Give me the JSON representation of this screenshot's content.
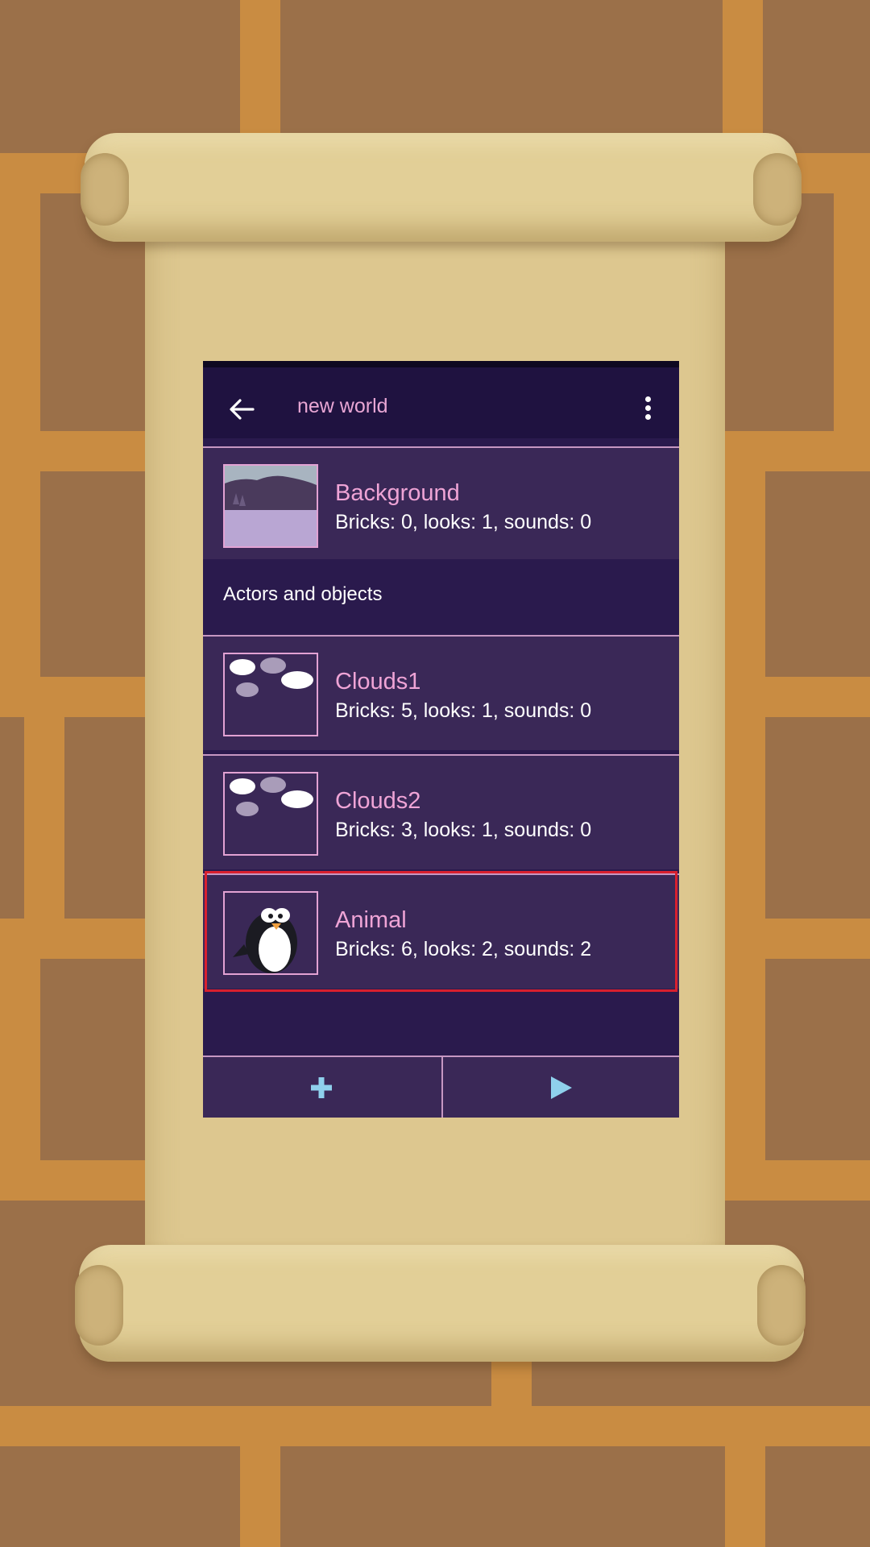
{
  "app": {
    "title": "new world",
    "background": {
      "name": "Background",
      "meta": "Bricks: 0, looks: 1, sounds: 0"
    },
    "section_header": "Actors and objects",
    "objects": [
      {
        "name": "Clouds1",
        "meta": "Bricks: 5, looks: 1, sounds: 0"
      },
      {
        "name": "Clouds2",
        "meta": "Bricks: 3, looks: 1, sounds: 0"
      },
      {
        "name": "Animal",
        "meta": "Bricks: 6, looks: 2, sounds: 2"
      }
    ]
  },
  "icons": {
    "back": "arrow-left-icon",
    "more": "more-vert-icon",
    "add": "plus-icon",
    "play": "play-icon"
  },
  "colors": {
    "toolbar": "#1f1240",
    "row_background": "#3a2857",
    "list_background": "#2a1a4d",
    "accent_pink": "#efa4d6",
    "icon_blue": "#8fd0ec",
    "selection_red": "#d8202e"
  }
}
